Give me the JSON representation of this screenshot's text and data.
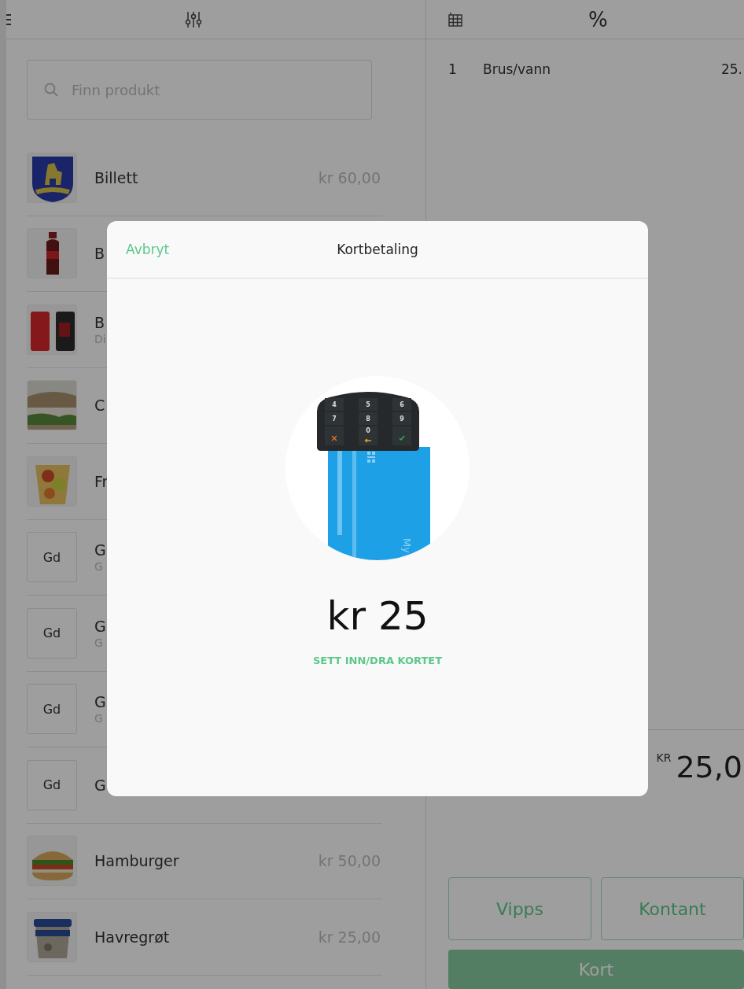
{
  "toolbar": {
    "percent_label": "%"
  },
  "search": {
    "placeholder": "Finn produkt"
  },
  "products": [
    {
      "kind": "picture",
      "name": "Billett",
      "price": "kr 60,00"
    },
    {
      "kind": "picture",
      "name": "B"
    },
    {
      "kind": "picture",
      "name": "B",
      "subtitle": "Di"
    },
    {
      "kind": "picture",
      "name": "C"
    },
    {
      "kind": "picture",
      "name": "Fr"
    },
    {
      "kind": "initials",
      "initials": "Gd",
      "name": "G",
      "subtitle": "G"
    },
    {
      "kind": "initials",
      "initials": "Gd",
      "name": "G",
      "subtitle": "G"
    },
    {
      "kind": "initials",
      "initials": "Gd",
      "name": "G",
      "subtitle": "G"
    },
    {
      "kind": "initials",
      "initials": "Gd",
      "name": "G"
    },
    {
      "kind": "picture",
      "name": "Hamburger",
      "price": "kr 50,00"
    },
    {
      "kind": "picture",
      "name": "Havregrøt",
      "price": "kr 25,00"
    }
  ],
  "order": {
    "lines": [
      {
        "qty": "1",
        "name": "Brus/vann",
        "amount": "25."
      }
    ],
    "currency": "KR",
    "total": "25,0"
  },
  "payment_buttons": [
    {
      "label": "Vipps",
      "kind": "outline"
    },
    {
      "label": "Kontant",
      "kind": "outline"
    },
    {
      "label": "Kort",
      "kind": "primary"
    }
  ],
  "modal": {
    "cancel": "Avbryt",
    "title": "Kortbetaling",
    "amount": "kr 25",
    "instruction": "SETT INN/DRA KORTET",
    "card_label": "My",
    "keypad": [
      {
        "kind": "digit",
        "label": "4"
      },
      {
        "kind": "digit",
        "label": "5"
      },
      {
        "kind": "digit",
        "label": "6"
      },
      {
        "kind": "digit",
        "label": "7"
      },
      {
        "kind": "digit",
        "label": "8"
      },
      {
        "kind": "digit",
        "label": "9"
      },
      {
        "kind": "cancel"
      },
      {
        "kind": "back",
        "label": "0"
      },
      {
        "kind": "ok"
      }
    ]
  }
}
